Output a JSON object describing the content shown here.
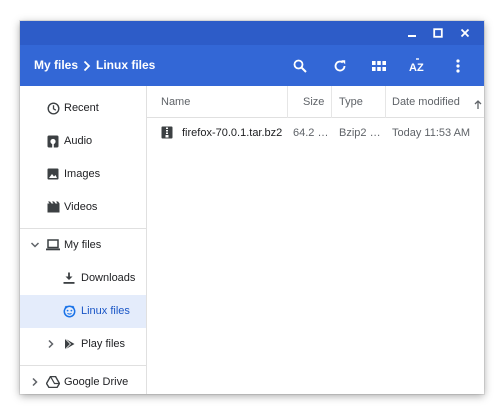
{
  "window": {
    "controls": [
      "minimize-icon",
      "maximize-icon",
      "close-icon"
    ]
  },
  "header": {
    "breadcrumb": [
      "My files",
      "Linux files"
    ],
    "tools": [
      "search-icon",
      "refresh-icon",
      "grid-view-icon",
      "sort-az-icon",
      "more-vert-icon"
    ]
  },
  "sidebar": {
    "items": [
      {
        "label": "Recent",
        "icon": "clock-icon"
      },
      {
        "label": "Audio",
        "icon": "audio-icon"
      },
      {
        "label": "Images",
        "icon": "image-icon"
      },
      {
        "label": "Videos",
        "icon": "video-icon"
      },
      {
        "label": "My files",
        "icon": "laptop-icon",
        "expanded": true
      },
      {
        "label": "Downloads",
        "icon": "download-icon"
      },
      {
        "label": "Linux files",
        "icon": "linux-icon",
        "selected": true
      },
      {
        "label": "Play files",
        "icon": "play-store-icon",
        "expanded": false
      },
      {
        "label": "Google Drive",
        "icon": "drive-icon",
        "expanded": false
      }
    ]
  },
  "table": {
    "columns": [
      "Name",
      "Size",
      "Type",
      "Date modified"
    ],
    "sort_indicator": "arrow-up-icon",
    "rows": [
      {
        "name": "firefox-70.0.1.tar.bz2",
        "size": "64.2 …",
        "type": "Bzip2 …",
        "date": "Today 11:53 AM",
        "icon": "archive-icon"
      }
    ]
  },
  "colors": {
    "titlebar": "#2d5cc8",
    "appbar": "#3367d6",
    "selection": "#e4ecfb",
    "accent_text": "#1a56c6"
  }
}
